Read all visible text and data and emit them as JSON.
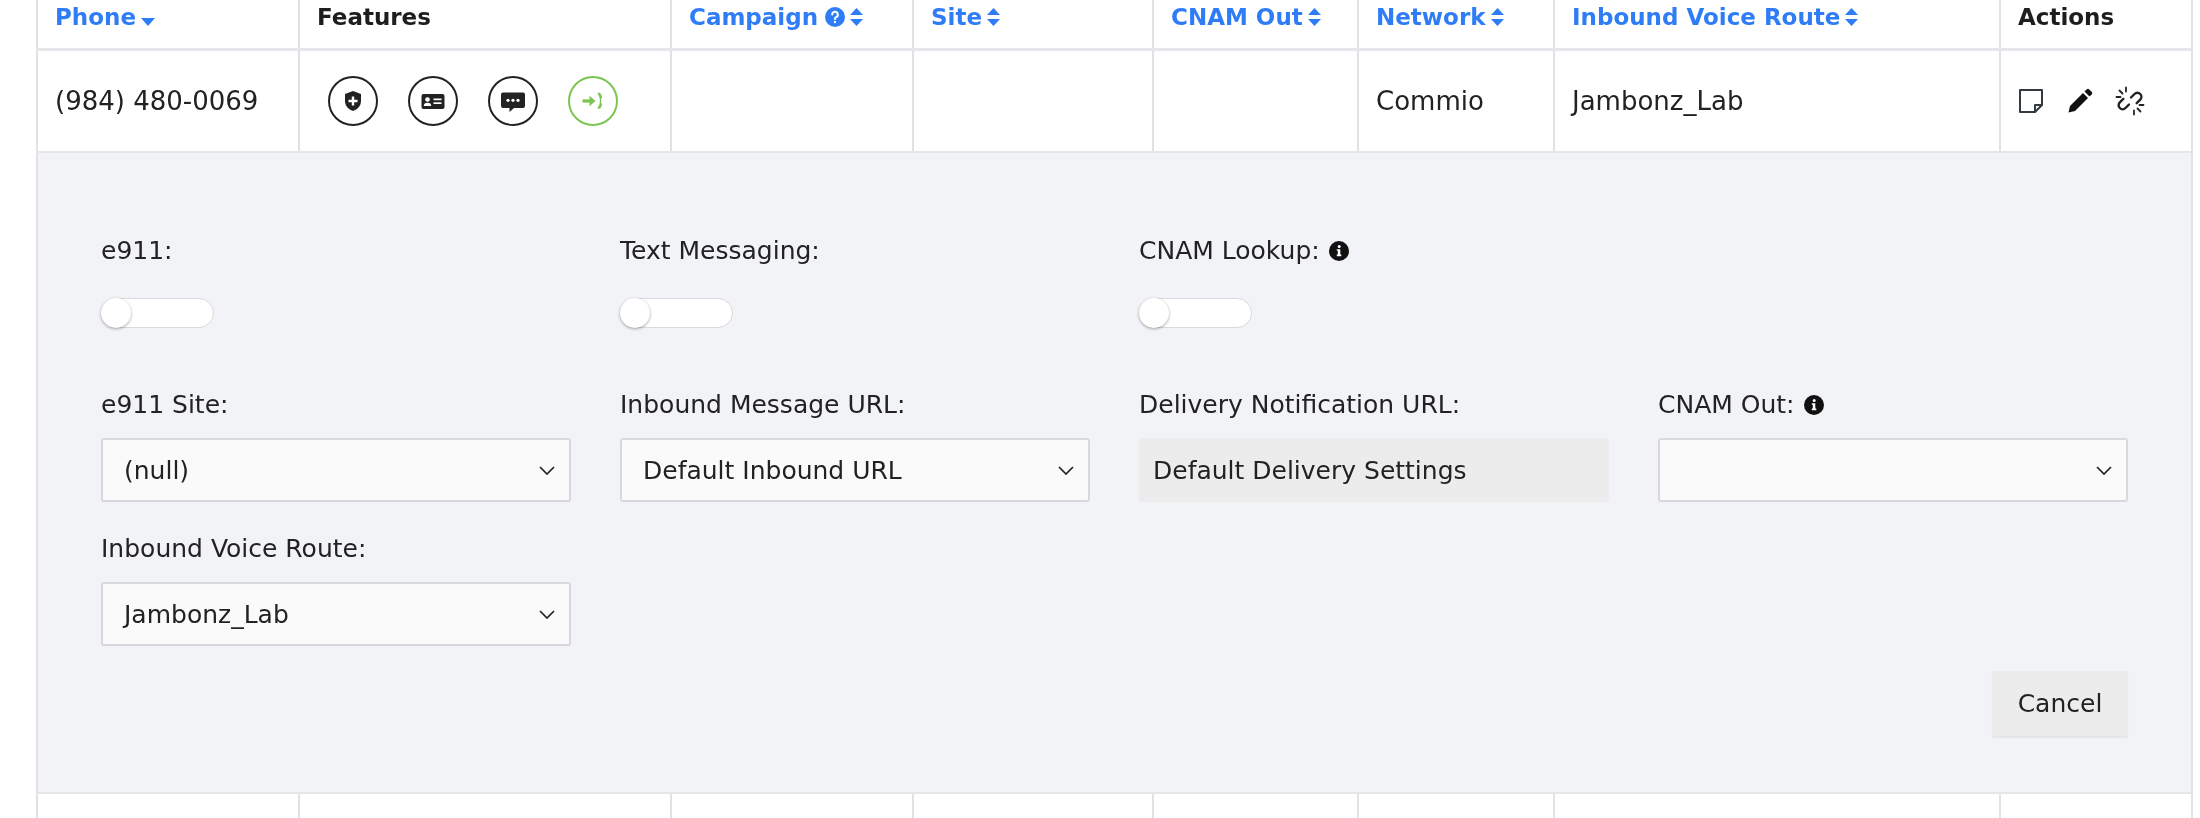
{
  "table": {
    "columns": [
      {
        "label": "Phone",
        "sortable": true,
        "sorted": true
      },
      {
        "label": "Features",
        "sortable": false
      },
      {
        "label": "Campaign",
        "sortable": true,
        "sorted": false,
        "help": true
      },
      {
        "label": "Site",
        "sortable": true,
        "sorted": false
      },
      {
        "label": "CNAM Out",
        "sortable": true,
        "sorted": false
      },
      {
        "label": "Network",
        "sortable": true,
        "sorted": false
      },
      {
        "label": "Inbound Voice Route",
        "sortable": true,
        "sorted": false
      },
      {
        "label": "Actions",
        "sortable": false
      }
    ],
    "rows": [
      {
        "phone": "(984) 480-0069",
        "features": [
          {
            "kind": "shield",
            "active": false
          },
          {
            "kind": "card",
            "active": false
          },
          {
            "kind": "chat",
            "active": false
          },
          {
            "kind": "phone",
            "active": true
          }
        ],
        "network": "Commio",
        "inbound_voice_route": "Jambonz_Lab",
        "actions": [
          {
            "kind": "note"
          },
          {
            "kind": "edit"
          },
          {
            "kind": "unlink"
          }
        ],
        "expanded": true,
        "details": {
          "rows": [
            [
              {
                "kind": "toggle",
                "label": "e911:",
                "on": false
              },
              {
                "kind": "toggle",
                "label": "Text Messaging:",
                "on": false
              },
              {
                "kind": "toggle",
                "label": "CNAM Lookup:",
                "info": true,
                "on": false
              }
            ],
            [
              {
                "kind": "select",
                "label": "e911 Site:",
                "value": "(null)"
              },
              {
                "kind": "select",
                "label": "Inbound Message URL:",
                "value": "Default Inbound URL"
              },
              {
                "kind": "readonly",
                "label": "Delivery Notification URL:",
                "value": "Default Delivery Settings"
              },
              {
                "kind": "select",
                "label": "CNAM Out:",
                "info": true
              }
            ],
            [
              {
                "kind": "select",
                "label": "Inbound Voice Route:",
                "value": "Jambonz_Lab"
              }
            ]
          ],
          "cancel_button": "Cancel"
        }
      }
    ]
  }
}
